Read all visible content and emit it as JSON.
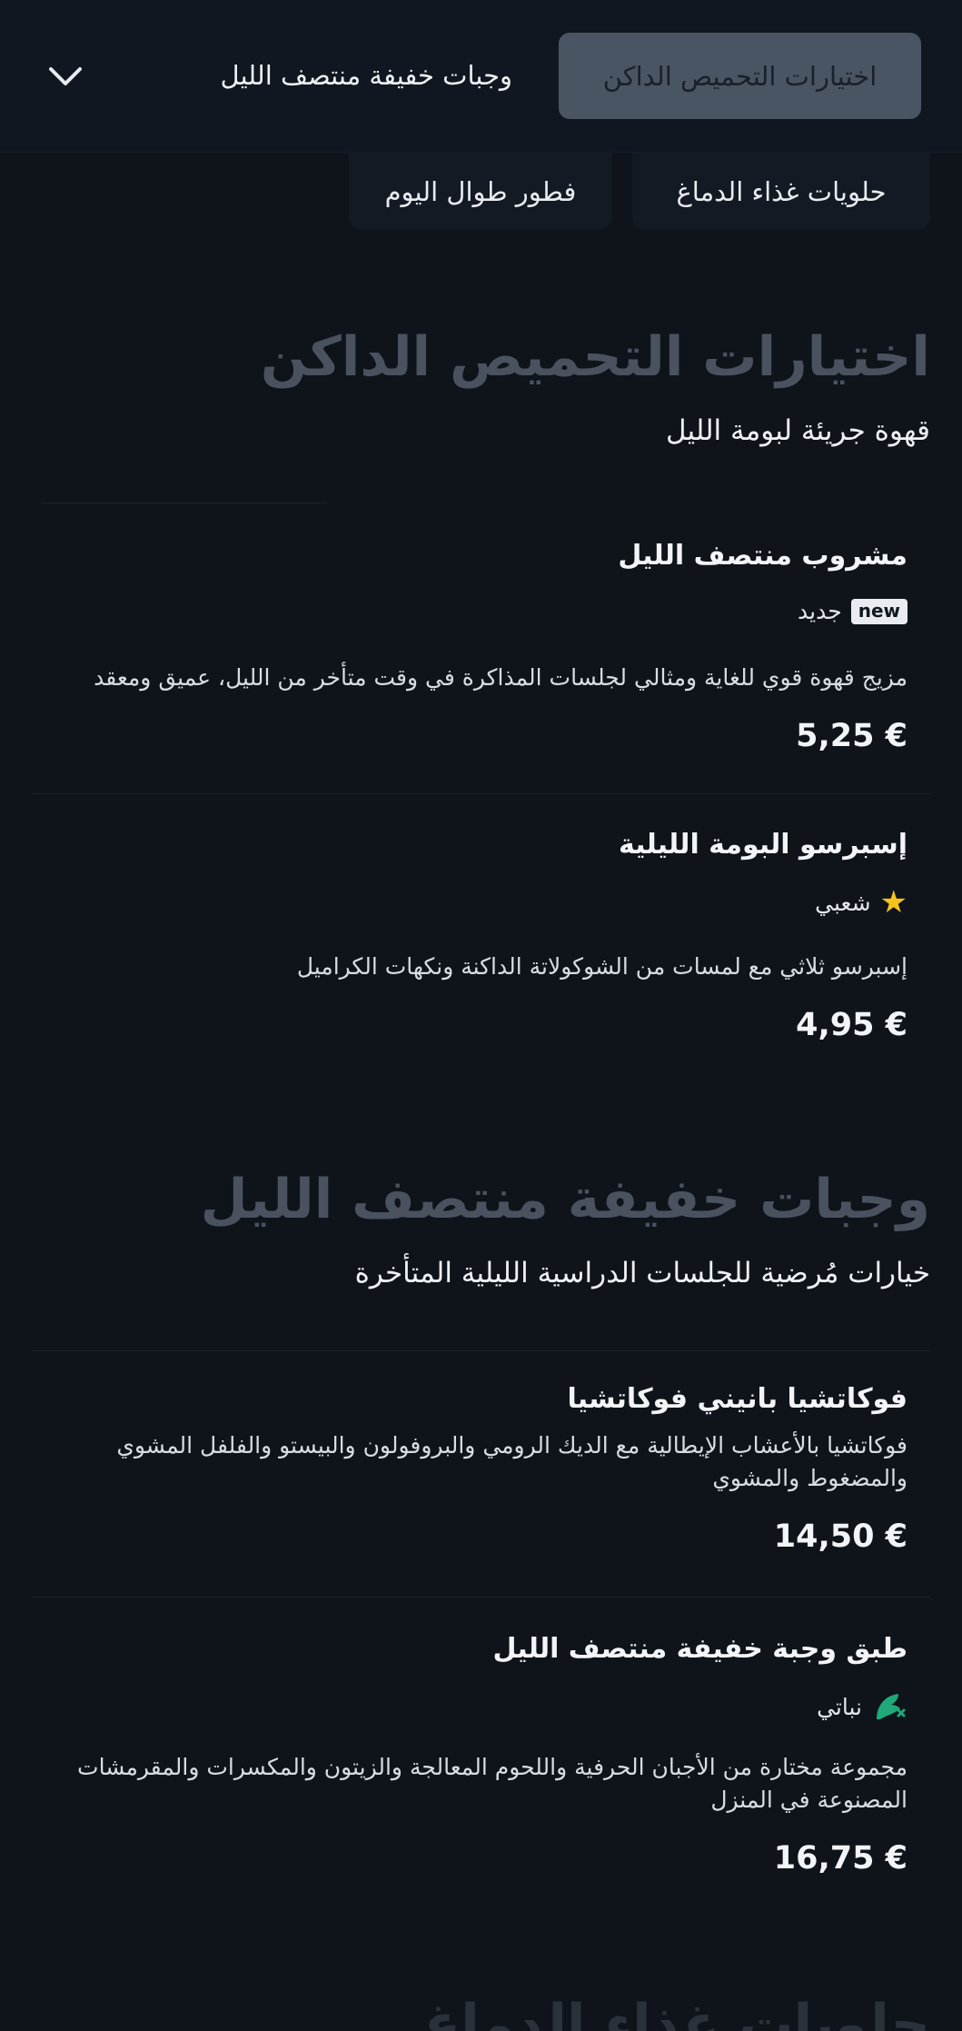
{
  "header": {
    "active_category": "اختيارات التحميص الداكن",
    "next_category": "وجبات خفيفة منتصف الليل",
    "toggle_icon": "chevron-down-icon"
  },
  "categories": [
    {
      "label": "حلويات غذاء الدماغ"
    },
    {
      "label": "فطور طوال اليوم"
    }
  ],
  "sections": [
    {
      "title": "اختيارات التحميص الداكن",
      "subtitle": "قهوة جريئة لبومة الليل",
      "items": [
        {
          "name": "مشروب منتصف الليل",
          "badge": "new",
          "tag": "جديد",
          "description": "مزيج قهوة قوي للغاية ومثالي لجلسات المذاكرة في وقت متأخر من الليل، عميق ومعقد",
          "price": "5,25 €"
        },
        {
          "name": "إسبرسو البومة الليلية",
          "tag_icon": "star-icon",
          "tag": "شعبي",
          "description": "إسبرسو ثلاثي مع لمسات من الشوكولاتة الداكنة ونكهات الكراميل",
          "price": "4,95 €"
        }
      ]
    },
    {
      "title": "وجبات خفيفة منتصف الليل",
      "subtitle": "خيارات مُرضية للجلسات الدراسية الليلية المتأخرة",
      "items": [
        {
          "name": "فوكاتشيا بانيني فوكاتشيا",
          "description_line1": "فوكاتشيا بالأعشاب الإيطالية مع الديك الرومي والبروفولون والبيستو والفلفل المشوي",
          "description_line2": "والمضغوط والمشوي",
          "price": "14,50 €"
        },
        {
          "name": "طبق وجبة خفيفة منتصف الليل",
          "tag_icon": "vegan-leaf-icon",
          "tag": "نباتي",
          "description_line1": "مجموعة مختارة من الأجبان الحرفية واللحوم المعالجة والزيتون والمكسرات والمقرمشات",
          "description_line2": "المصنوعة في المنزل",
          "price": "16,75 €"
        }
      ]
    }
  ],
  "colors": {
    "background": "#0f141b",
    "active_chip": "#4a5563",
    "section_title": "#4a5260",
    "star": "#f5c31c",
    "vegan": "#1fa97a"
  }
}
